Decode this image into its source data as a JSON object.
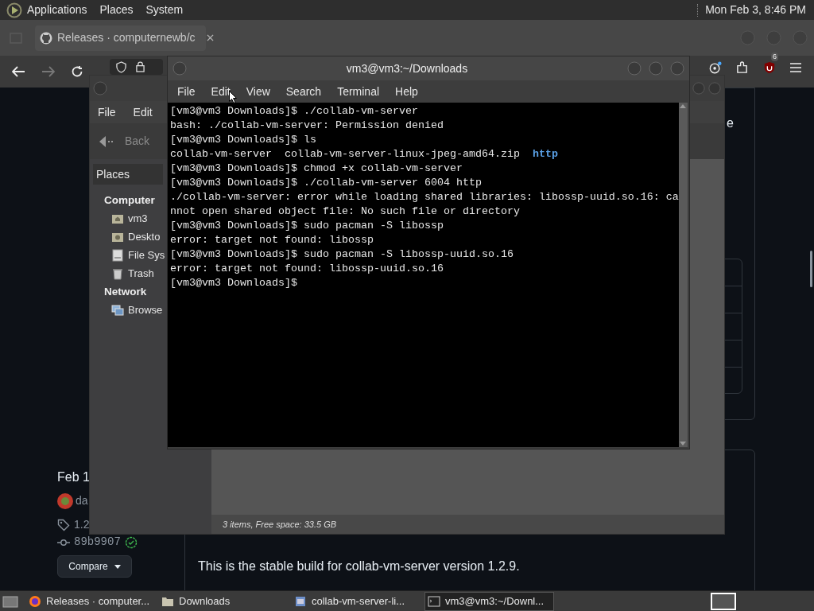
{
  "top_panel": {
    "menus": [
      "Applications",
      "Places",
      "System"
    ],
    "clock": "Mon Feb 3, 8:46 PM"
  },
  "browser": {
    "tabs": [
      {
        "title": "Releases · computernewb/c",
        "selected": true
      }
    ],
    "extension_badge": "6",
    "page": {
      "heading_fragment": "e",
      "date": "Feb 1",
      "author": "da",
      "tag": "1.2",
      "commit": "89b9907",
      "compare_button": "Compare",
      "description": "This is the stable build for collab-vm-server version 1.2.9."
    }
  },
  "file_manager": {
    "menu": [
      "File",
      "Edit"
    ],
    "back_button": "Back",
    "sidebar_header": "Places",
    "sections": [
      {
        "title": "Computer",
        "items": [
          {
            "label": "vm3",
            "kind": "home"
          },
          {
            "label": "Deskto",
            "kind": "desktop"
          },
          {
            "label": "File Sys",
            "kind": "drive"
          },
          {
            "label": "Trash",
            "kind": "trash"
          }
        ]
      },
      {
        "title": "Network",
        "items": [
          {
            "label": "Browse",
            "kind": "network"
          }
        ]
      }
    ],
    "status": "3 items, Free space: 33.5 GB"
  },
  "terminal": {
    "title": "vm3@vm3:~/Downloads",
    "menu": [
      "File",
      "Edit",
      "View",
      "Search",
      "Terminal",
      "Help"
    ],
    "lines": [
      {
        "segments": [
          {
            "text": "[vm3@vm3 Downloads]$ ./collab-vm-server",
            "kind": "plain"
          }
        ]
      },
      {
        "segments": [
          {
            "text": "bash: ./collab-vm-server: Permission denied",
            "kind": "plain"
          }
        ]
      },
      {
        "segments": [
          {
            "text": "[vm3@vm3 Downloads]$ ls",
            "kind": "plain"
          }
        ]
      },
      {
        "segments": [
          {
            "text": "collab-vm-server  collab-vm-server-linux-jpeg-amd64.zip  ",
            "kind": "plain"
          },
          {
            "text": "http",
            "kind": "directory"
          }
        ]
      },
      {
        "segments": [
          {
            "text": "[vm3@vm3 Downloads]$ chmod +x collab-vm-server",
            "kind": "plain"
          }
        ]
      },
      {
        "segments": [
          {
            "text": "[vm3@vm3 Downloads]$ ./collab-vm-server 6004 http",
            "kind": "plain"
          }
        ]
      },
      {
        "segments": [
          {
            "text": "./collab-vm-server: error while loading shared libraries: libossp-uuid.so.16: ca",
            "kind": "plain"
          }
        ]
      },
      {
        "segments": [
          {
            "text": "nnot open shared object file: No such file or directory",
            "kind": "plain"
          }
        ]
      },
      {
        "segments": [
          {
            "text": "[vm3@vm3 Downloads]$ sudo pacman -S libossp",
            "kind": "plain"
          }
        ]
      },
      {
        "segments": [
          {
            "text": "error: target not found: libossp",
            "kind": "plain"
          }
        ]
      },
      {
        "segments": [
          {
            "text": "[vm3@vm3 Downloads]$ sudo pacman -S libossp-uuid.so.16",
            "kind": "plain"
          }
        ]
      },
      {
        "segments": [
          {
            "text": "error: target not found: libossp-uuid.so.16",
            "kind": "plain"
          }
        ]
      },
      {
        "segments": [
          {
            "text": "[vm3@vm3 Downloads]$ ",
            "kind": "plain"
          }
        ]
      }
    ]
  },
  "taskbar": {
    "tasks": [
      {
        "label": "Releases · computer...",
        "kind": "browser",
        "selected": false
      },
      {
        "label": "Downloads",
        "kind": "folder",
        "selected": false
      },
      {
        "label": "collab-vm-server-li...",
        "kind": "archive",
        "selected": false
      },
      {
        "label": "vm3@vm3:~/Downl...",
        "kind": "terminal",
        "selected": true
      }
    ]
  }
}
